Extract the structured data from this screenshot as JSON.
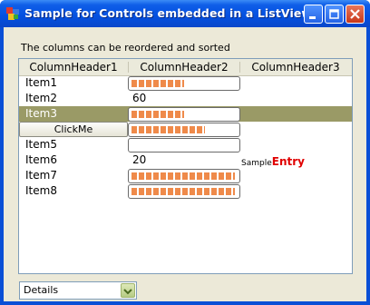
{
  "window": {
    "title": "Sample for Controls embedded in a ListView",
    "icons": {
      "app": "app-icon",
      "minimize": "minimize-icon",
      "maximize": "maximize-icon",
      "close": "close-icon"
    }
  },
  "caption": "The columns can be reordered and sorted",
  "listview": {
    "columns": [
      "ColumnHeader1",
      "ColumnHeader2",
      "ColumnHeader3"
    ],
    "rows": [
      {
        "label": "Item1",
        "progress": 0.5
      },
      {
        "label": "Item2",
        "value": "60"
      },
      {
        "label": "Item3",
        "progress": 0.5,
        "selected": true
      },
      {
        "button": "ClickMe",
        "progress": 0.7
      },
      {
        "label": "Item5",
        "progress": 0
      },
      {
        "label": "Item6",
        "value": "20",
        "entry_small": "Sample",
        "entry_big": "Entry"
      },
      {
        "label": "Item7",
        "progress": 0.98
      },
      {
        "label": "Item8",
        "progress": 0.98
      }
    ]
  },
  "view_selector": {
    "value": "Details",
    "icon": "chevron-down-icon"
  },
  "colors": {
    "selected_row": "#9a9a66",
    "progress": "#ef8a4a",
    "entry_accent": "#e00000"
  }
}
